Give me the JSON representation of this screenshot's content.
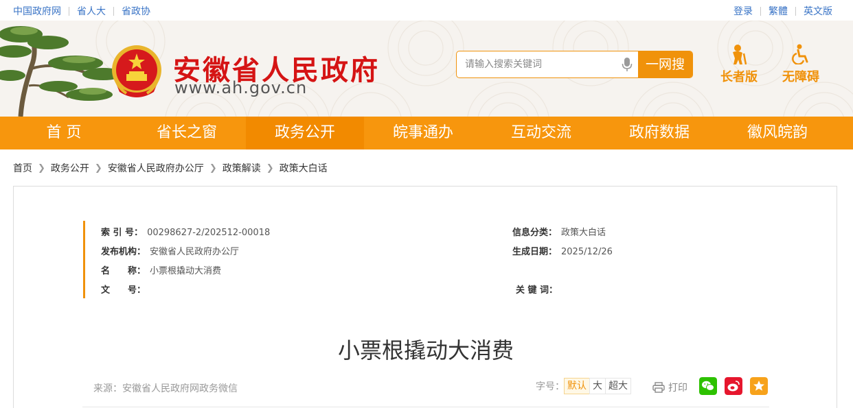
{
  "topbar": {
    "links": [
      "中国政府网",
      "省人大",
      "省政协"
    ],
    "user_links": [
      "登录",
      "繁體",
      "英文版"
    ]
  },
  "header": {
    "site_title": "安徽省人民政府",
    "site_url": "www.ah.gov.cn",
    "search_placeholder": "请输入搜索关键词",
    "search_button": "一网搜",
    "elder_mode": "长者版",
    "accessible_mode": "无障碍"
  },
  "nav": {
    "items": [
      "首 页",
      "省长之窗",
      "政务公开",
      "皖事通办",
      "互动交流",
      "政府数据",
      "徽风皖韵"
    ],
    "active_index": 2
  },
  "breadcrumb": [
    "首页",
    "政务公开",
    "安徽省人民政府办公厅",
    "政策解读",
    "政策大白话"
  ],
  "meta": {
    "index_label": "索 引 号：",
    "index_value": "00298627-2/202512-00018",
    "category_label": "信息分类：",
    "category_value": "政策大白话",
    "publisher_label": "发布机构：",
    "publisher_value": "安徽省人民政府办公厅",
    "date_label": "生成日期：",
    "date_value": "2025/12/26",
    "name_label": "名　　称：",
    "name_value": "小票根撬动大消费",
    "docno_label": "文　　号：",
    "docno_value": "",
    "keywords_label": "关 键 词：",
    "keywords_value": ""
  },
  "article": {
    "title": "小票根撬动大消费",
    "source": "来源：安徽省人民政府网政务微信",
    "fontsize_label": "字号：",
    "fontsize_options": [
      "默认",
      "大",
      "超大"
    ],
    "print_label": "打印"
  },
  "colors": {
    "accent": "#f7960d",
    "title_red": "#d51414",
    "link_blue": "#3a74c6",
    "wechat": "#2dc100",
    "weibo": "#e6162d",
    "favorite": "#f7a21b"
  }
}
